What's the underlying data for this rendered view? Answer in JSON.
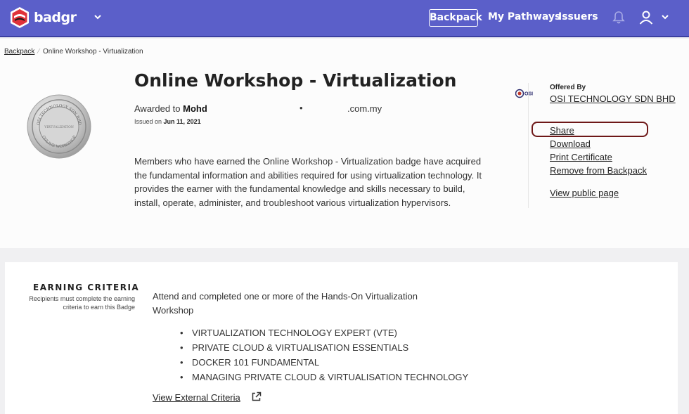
{
  "nav": {
    "brand": "badgr",
    "links": {
      "backpack": "Backpack",
      "pathways": "My Pathways",
      "issuers": "Issuers"
    },
    "icons": {
      "logo": "badgr-logo-icon",
      "bell": "bell-icon",
      "user": "user-icon",
      "chevron": "chevron-down-icon"
    },
    "accent": "#5b5fc9"
  },
  "breadcrumb": {
    "root": "Backpack",
    "current": "Online Workshop - Virtualization"
  },
  "badge": {
    "title": "Online Workshop - Virtualization",
    "awarded_prefix": "Awarded to",
    "recipient": "Mohd",
    "email_dot": "•",
    "email_domain": ".com.my",
    "issued_prefix": "Issued on",
    "issued_date": "Jun 11, 2021",
    "description": "Members who have earned the Online Workshop - Virtualization badge have acquired the fundamental information and abilities required for using virtualization technology. It provides the earner with the fundamental knowledge and skills necessary to build, install, operate, administer, and troubleshoot various virtualization hypervisors.",
    "image_text_top": "OSI TECHNOLOGY SDN BHD",
    "image_text_bottom": "ONLINE WORKSHOP",
    "image_text_center": "VIRTUALIZATION"
  },
  "sidebar": {
    "offered_by_label": "Offered By",
    "org_name": "OSI TECHNOLOGY SDN BHD",
    "org_logo_text": "OSI",
    "actions": {
      "share": "Share",
      "download": "Download",
      "print": "Print Certificate",
      "remove": "Remove from Backpack",
      "public": "View public page"
    },
    "highlight_color": "#6e1818"
  },
  "criteria": {
    "title": "EARNING CRITERIA",
    "subtitle": "Recipients must complete the earning criteria to earn this Badge",
    "text": "Attend and completed one or more of the Hands-On Virtualization Workshop",
    "items": [
      "VIRTUALIZATION TECHNOLOGY EXPERT (VTE)",
      "PRIVATE CLOUD & VIRTUALISATION ESSENTIALS",
      "DOCKER 101 FUNDAMENTAL",
      "MANAGING PRIVATE CLOUD & VIRTUALISATION TECHNOLOGY"
    ],
    "external_link": "View External Criteria",
    "external_icon": "external-link-icon"
  }
}
